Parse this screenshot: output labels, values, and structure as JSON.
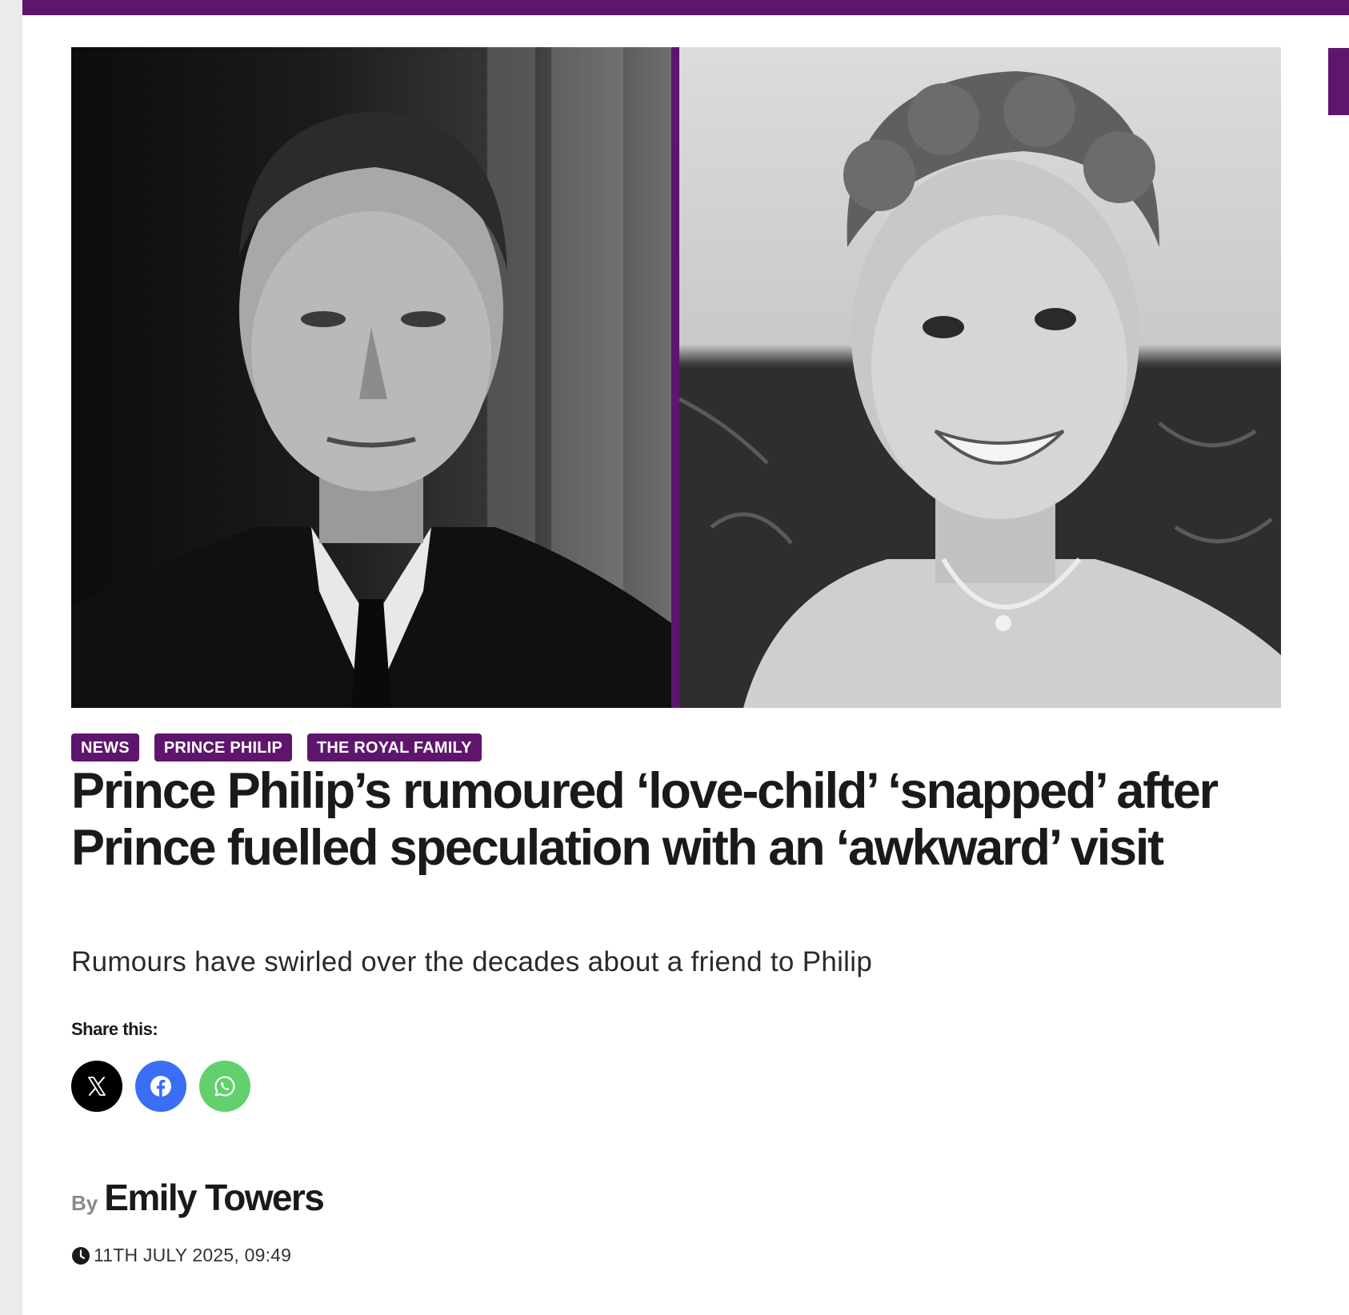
{
  "brand": {
    "accent_color": "#5e166c"
  },
  "hero": {
    "left_image": "portrait-man-icon",
    "right_image": "portrait-woman-icon"
  },
  "tags": [
    {
      "label": "NEWS"
    },
    {
      "label": "PRINCE PHILIP"
    },
    {
      "label": "THE ROYAL FAMILY"
    }
  ],
  "article": {
    "headline": "Prince Philip’s rumoured ‘love-child’ ‘snapped’ after Prince fuelled speculation with an ‘awkward’ visit",
    "standfirst": "Rumours have swirled over the decades about a friend to Philip"
  },
  "share": {
    "label": "Share this:",
    "buttons": [
      {
        "icon": "x-icon",
        "color": "#000000"
      },
      {
        "icon": "facebook-icon",
        "color": "#3b6ef5"
      },
      {
        "icon": "whatsapp-icon",
        "color": "#62d06d"
      }
    ]
  },
  "byline": {
    "by": "By",
    "author": "Emily Towers"
  },
  "meta": {
    "date": "11TH JULY 2025, 09:49"
  }
}
